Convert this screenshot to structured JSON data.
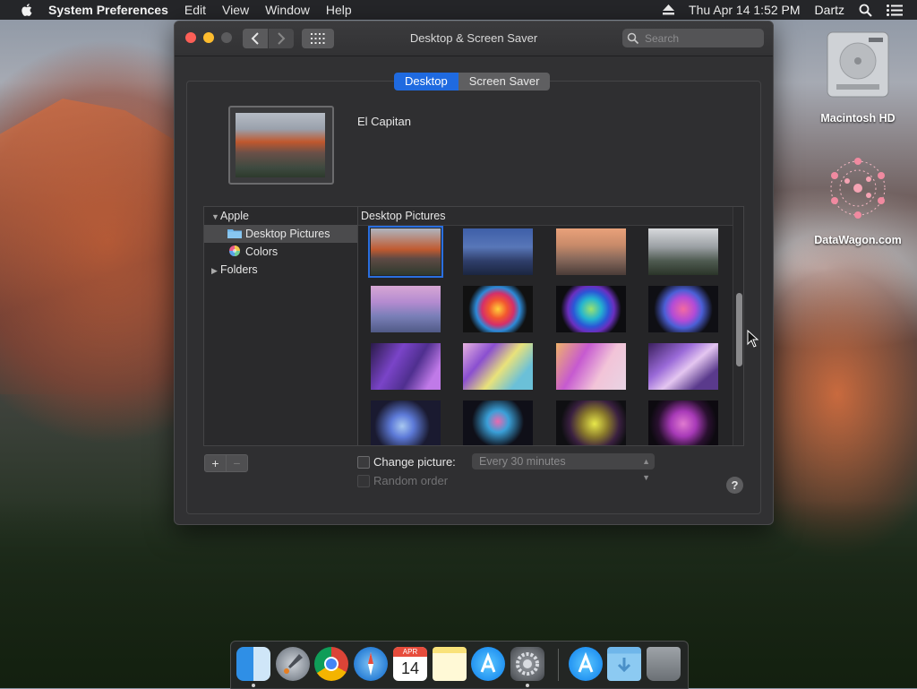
{
  "menubar": {
    "app_name": "System Preferences",
    "menus": [
      "Edit",
      "View",
      "Window",
      "Help"
    ],
    "datetime": "Thu Apr 14  1:52 PM",
    "user": "Dartz"
  },
  "window": {
    "title": "Desktop & Screen Saver",
    "search_placeholder": "Search"
  },
  "tabs": {
    "desktop": "Desktop",
    "screen_saver": "Screen Saver",
    "active": "Desktop"
  },
  "preview": {
    "name": "El Capitan"
  },
  "sources": {
    "apple": "Apple",
    "desktop_pictures": "Desktop Pictures",
    "colors": "Colors",
    "folders": "Folders",
    "selected": "Desktop Pictures"
  },
  "grid": {
    "header": "Desktop Pictures",
    "selected_index": 0
  },
  "options": {
    "change_picture_label": "Change picture:",
    "change_picture_checked": false,
    "interval": "Every 30 minutes",
    "random_order_label": "Random order",
    "random_order_checked": false,
    "help": "?"
  },
  "desktop_icons": {
    "hd": "Macintosh HD",
    "site": "DataWagon.com"
  },
  "dock": {
    "calendar_month": "APR",
    "calendar_day": "14"
  },
  "colors": {
    "accent": "#1f6ae0",
    "window_bg": "#313133"
  }
}
